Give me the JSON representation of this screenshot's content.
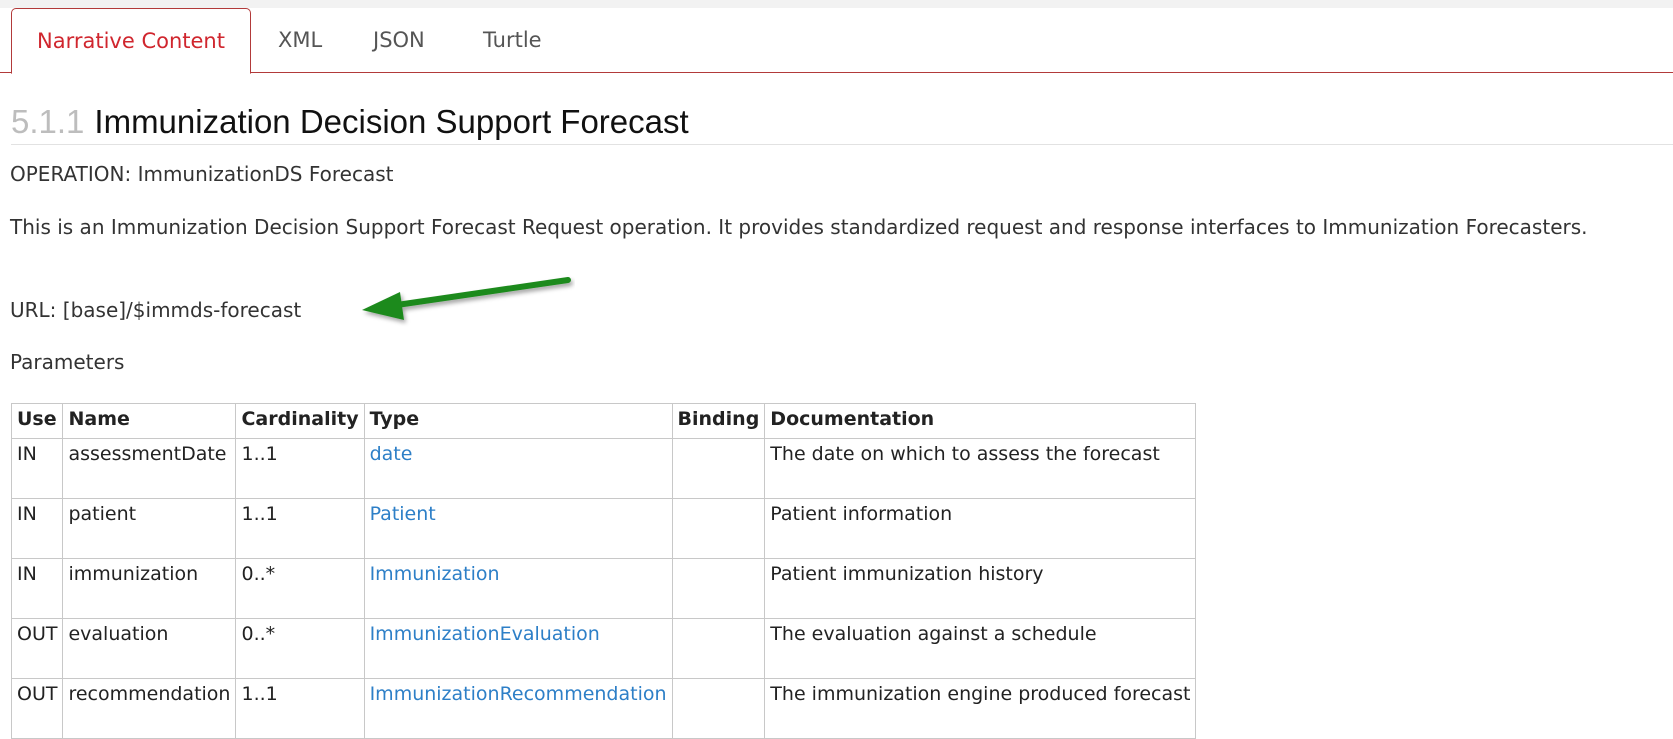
{
  "tabs": [
    {
      "label": "Narrative Content",
      "active": true
    },
    {
      "label": "XML",
      "active": false
    },
    {
      "label": "JSON",
      "active": false
    },
    {
      "label": "Turtle",
      "active": false
    }
  ],
  "heading": {
    "number": "5.1.1",
    "title": "Immunization Decision Support Forecast"
  },
  "operation": "OPERATION: ImmunizationDS Forecast",
  "description": "This is an Immunization Decision Support Forecast Request operation. It provides standardized request and response interfaces to Immunization Forecasters.",
  "url_line": "URL: [base]/$immds-forecast",
  "parameters_label": "Parameters",
  "table": {
    "headers": [
      "Use",
      "Name",
      "Cardinality",
      "Type",
      "Binding",
      "Documentation"
    ],
    "rows": [
      {
        "use": "IN",
        "name": "assessmentDate",
        "card": "1..1",
        "type": "date",
        "binding": "",
        "doc": "The date on which to assess the forecast"
      },
      {
        "use": "IN",
        "name": "patient",
        "card": "1..1",
        "type": "Patient",
        "binding": "",
        "doc": "Patient information"
      },
      {
        "use": "IN",
        "name": "immunization",
        "card": "0..*",
        "type": "Immunization",
        "binding": "",
        "doc": "Patient immunization history"
      },
      {
        "use": "OUT",
        "name": "evaluation",
        "card": "0..*",
        "type": "ImmunizationEvaluation",
        "binding": "",
        "doc": "The evaluation against a schedule"
      },
      {
        "use": "OUT",
        "name": "recommendation",
        "card": "1..1",
        "type": "ImmunizationRecommendation",
        "binding": "",
        "doc": "The immunization engine produced forecast"
      }
    ]
  },
  "colors": {
    "accent": "#d0262e",
    "link": "#2d7fc7",
    "arrow": "#1f8a1f"
  },
  "icons": {
    "annotation": "arrow-left-icon"
  }
}
